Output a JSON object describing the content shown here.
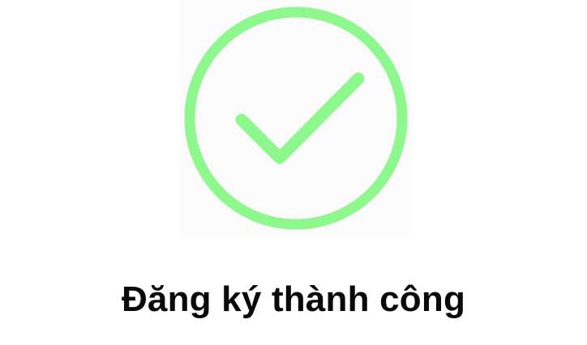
{
  "success_screen": {
    "icon": "check-circle-icon",
    "icon_color": "#8EF78E",
    "panel_color": "#FBFBFB",
    "message": "Đăng ký thành công"
  }
}
